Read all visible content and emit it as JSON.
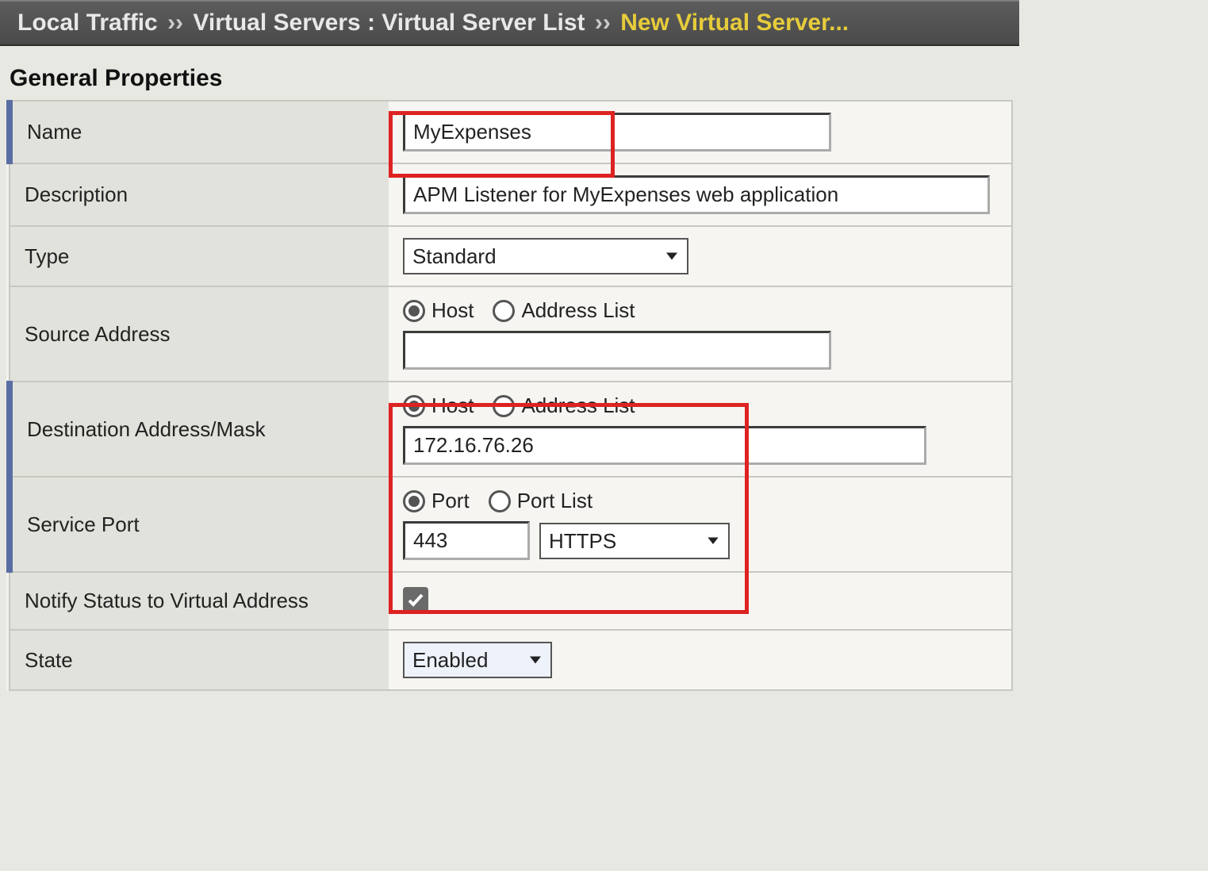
{
  "breadcrumb": {
    "root": "Local Traffic",
    "sep": "››",
    "mid": "Virtual Servers : Virtual Server List",
    "current": "New Virtual Server..."
  },
  "section_title": "General Properties",
  "fields": {
    "name": {
      "label": "Name",
      "value": "MyExpenses"
    },
    "description": {
      "label": "Description",
      "value": "APM Listener for MyExpenses web application"
    },
    "type": {
      "label": "Type",
      "value": "Standard"
    },
    "source": {
      "label": "Source Address",
      "radio_host": "Host",
      "radio_list": "Address List",
      "value": ""
    },
    "dest": {
      "label": "Destination Address/Mask",
      "radio_host": "Host",
      "radio_list": "Address List",
      "value": "172.16.76.26"
    },
    "port": {
      "label": "Service Port",
      "radio_port": "Port",
      "radio_list": "Port List",
      "value": "443",
      "proto": "HTTPS"
    },
    "notify": {
      "label": "Notify Status to Virtual Address",
      "checked": true
    },
    "state": {
      "label": "State",
      "value": "Enabled"
    }
  }
}
